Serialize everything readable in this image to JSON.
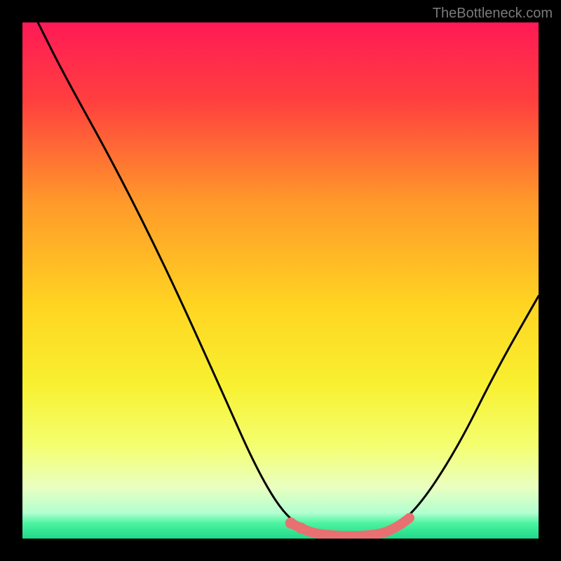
{
  "watermark": "TheBottleneck.com",
  "chart_data": {
    "type": "line",
    "title": "",
    "xlabel": "",
    "ylabel": "",
    "xlim": [
      0,
      100
    ],
    "ylim": [
      0,
      100
    ],
    "grid": false,
    "legend": false,
    "gradient_stops": [
      {
        "offset": 0.0,
        "color": "#ff1a56"
      },
      {
        "offset": 0.15,
        "color": "#ff3f3f"
      },
      {
        "offset": 0.35,
        "color": "#ff9a2a"
      },
      {
        "offset": 0.55,
        "color": "#ffd522"
      },
      {
        "offset": 0.7,
        "color": "#f8f030"
      },
      {
        "offset": 0.82,
        "color": "#f4ff70"
      },
      {
        "offset": 0.9,
        "color": "#eaffc0"
      },
      {
        "offset": 0.95,
        "color": "#b3ffd0"
      },
      {
        "offset": 0.97,
        "color": "#4cf4a0"
      },
      {
        "offset": 1.0,
        "color": "#1fd98a"
      }
    ],
    "series": [
      {
        "name": "bottleneck-curve",
        "color": "#000000",
        "points": [
          {
            "x": 3,
            "y": 100
          },
          {
            "x": 8,
            "y": 90
          },
          {
            "x": 18,
            "y": 72
          },
          {
            "x": 28,
            "y": 52
          },
          {
            "x": 38,
            "y": 30
          },
          {
            "x": 46,
            "y": 12
          },
          {
            "x": 52,
            "y": 3
          },
          {
            "x": 58,
            "y": 0.8
          },
          {
            "x": 64,
            "y": 0.5
          },
          {
            "x": 70,
            "y": 1.0
          },
          {
            "x": 76,
            "y": 5
          },
          {
            "x": 84,
            "y": 17
          },
          {
            "x": 92,
            "y": 33
          },
          {
            "x": 100,
            "y": 47
          }
        ]
      },
      {
        "name": "highlight-segment",
        "color": "#e87070",
        "stroke_width": 14,
        "points": [
          {
            "x": 52,
            "y": 3
          },
          {
            "x": 54,
            "y": 2
          },
          {
            "x": 56,
            "y": 1.2
          },
          {
            "x": 58,
            "y": 0.8
          },
          {
            "x": 62,
            "y": 0.5
          },
          {
            "x": 66,
            "y": 0.5
          },
          {
            "x": 70,
            "y": 1.0
          },
          {
            "x": 73,
            "y": 2.5
          },
          {
            "x": 75,
            "y": 4
          }
        ]
      }
    ],
    "highlight_dots": [
      {
        "x": 52,
        "y": 3
      },
      {
        "x": 54,
        "y": 2
      }
    ]
  }
}
